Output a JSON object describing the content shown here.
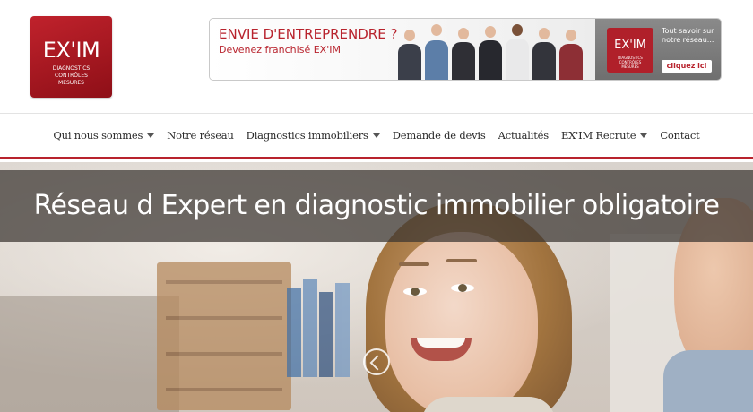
{
  "colors": {
    "brand_red": "#b8232d",
    "nav_text": "#2a2a2a"
  },
  "logo": {
    "word": "EX'IM",
    "sub_lines": [
      "DIAGNOSTICS",
      "CONTRÔLES",
      "MESURES"
    ]
  },
  "banner": {
    "headline": "ENVIE D'ENTREPRENDRE ?",
    "subline": "Devenez franchisé EX'IM",
    "mini_logo_word": "EX'IM",
    "mini_logo_sub": [
      "DIAGNOSTICS",
      "CONTRÔLES",
      "MESURES"
    ],
    "cta_text": "Tout savoir sur notre réseau...",
    "cta_button": "cliquez ici"
  },
  "nav": {
    "items": [
      {
        "label": "Qui nous sommes",
        "dropdown": true
      },
      {
        "label": "Notre réseau",
        "dropdown": false
      },
      {
        "label": "Diagnostics immobiliers",
        "dropdown": true
      },
      {
        "label": "Demande de devis",
        "dropdown": false
      },
      {
        "label": "Actualités",
        "dropdown": false
      },
      {
        "label": "EX'IM Recrute",
        "dropdown": true
      },
      {
        "label": "Contact",
        "dropdown": false
      }
    ]
  },
  "hero": {
    "title": "Réseau d Expert en diagnostic immobilier obligatoire",
    "slider_icon": "chevron-up-icon"
  }
}
